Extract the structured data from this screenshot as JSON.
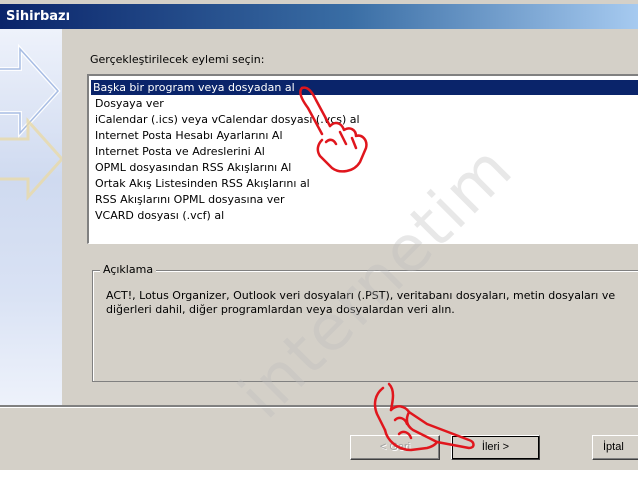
{
  "window": {
    "title": "Sihirbazı"
  },
  "prompt": "Gerçekleştirilecek eylemi seçin:",
  "actions": [
    "Başka bir program veya dosyadan al",
    "Dosyaya ver",
    "iCalendar (.ics) veya vCalendar dosyası (.vcs) al",
    "Internet Posta Hesabı Ayarlarını Al",
    "Internet Posta ve Adreslerini Al",
    "OPML dosyasından RSS Akışlarını Al",
    "Ortak Akış Listesinden RSS Akışlarını al",
    "RSS Akışlarını OPML dosyasına ver",
    "VCARD dosyası (.vcf) al"
  ],
  "selected_index": 0,
  "description": {
    "title": "Açıklama",
    "text": "ACT!, Lotus Organizer, Outlook veri dosyaları (.PST), veritabanı dosyaları, metin dosyaları ve diğerleri dahil, diğer programlardan veya dosyalardan veri alın."
  },
  "buttons": {
    "back": "< Geri",
    "next": "İleri >",
    "cancel": "İptal"
  },
  "watermark": "internetim",
  "colors": {
    "selection": "#0a246a",
    "dialog_bg": "#d4d0c8",
    "hand": "#e0161d"
  }
}
